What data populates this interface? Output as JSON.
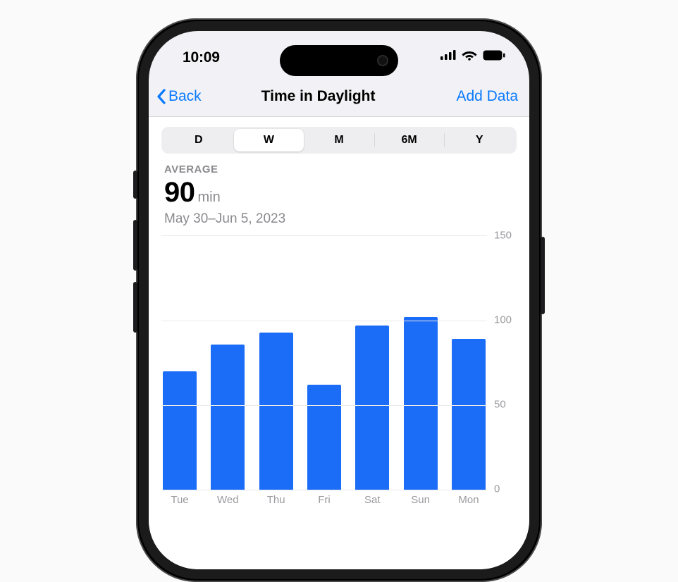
{
  "status": {
    "time": "10:09"
  },
  "nav": {
    "back_label": "Back",
    "title": "Time in Daylight",
    "add_label": "Add Data"
  },
  "segmented": {
    "items": [
      "D",
      "W",
      "M",
      "6M",
      "Y"
    ],
    "selected_index": 1
  },
  "summary": {
    "label": "AVERAGE",
    "value": "90",
    "unit": "min",
    "range": "May 30–Jun 5, 2023"
  },
  "chart_data": {
    "type": "bar",
    "categories": [
      "Tue",
      "Wed",
      "Thu",
      "Fri",
      "Sat",
      "Sun",
      "Mon"
    ],
    "values": [
      70,
      86,
      93,
      62,
      97,
      102,
      89
    ],
    "title": "Time in Daylight",
    "xlabel": "",
    "ylabel": "",
    "ylim": [
      0,
      150
    ],
    "yticks": [
      0,
      50,
      100,
      150
    ],
    "color": "#1b6cf6"
  }
}
